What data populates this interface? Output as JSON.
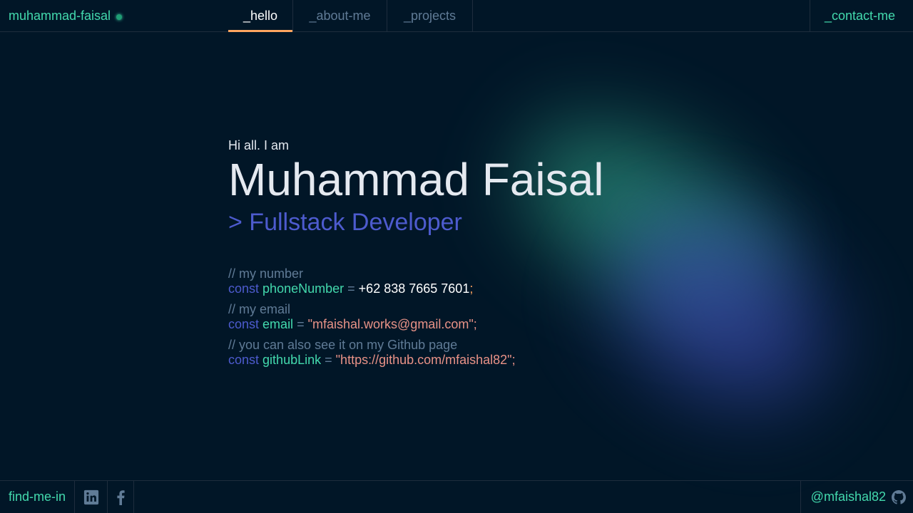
{
  "header": {
    "brand": "muhammad-faisal",
    "tabs": [
      {
        "label": "_hello"
      },
      {
        "label": "_about-me"
      },
      {
        "label": "_projects"
      }
    ],
    "contact": "_contact-me"
  },
  "hero": {
    "greeting": "Hi all. I am",
    "name": "Muhammad Faisal",
    "role": "> Fullstack Developer"
  },
  "code": {
    "phone": {
      "comment": "// my number",
      "keyword": "const",
      "variable": "phoneNumber",
      "operator": "=",
      "value": "+62 838 7665 7601",
      "terminator": ";"
    },
    "email": {
      "comment": "// my email",
      "keyword": "const",
      "variable": "email",
      "operator": "=",
      "value": "\"mfaishal.works@gmail.com\"",
      "terminator": ";"
    },
    "github": {
      "comment": "// you can also see it on my Github page",
      "keyword": "const",
      "variable": "githubLink",
      "operator": "=",
      "value": "\"https://github.com/mfaishal82\"",
      "terminator": ";"
    }
  },
  "footer": {
    "label": "find-me-in",
    "social_icons": [
      "linkedin-icon",
      "facebook-icon"
    ],
    "github_handle": "@mfaishal82",
    "github_icon": "github-icon"
  },
  "colors": {
    "background": "#011627",
    "accent_green": "#43d9ad",
    "accent_orange": "#fea55f",
    "accent_blue": "#4d5bce",
    "comment_gray": "#607b96",
    "string_salmon": "#e99287"
  }
}
